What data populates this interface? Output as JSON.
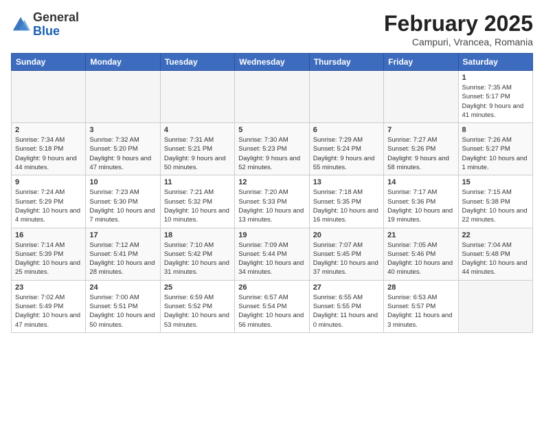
{
  "logo": {
    "general": "General",
    "blue": "Blue"
  },
  "title": {
    "month_year": "February 2025",
    "location": "Campuri, Vrancea, Romania"
  },
  "weekdays": [
    "Sunday",
    "Monday",
    "Tuesday",
    "Wednesday",
    "Thursday",
    "Friday",
    "Saturday"
  ],
  "weeks": [
    [
      {
        "day": "",
        "info": ""
      },
      {
        "day": "",
        "info": ""
      },
      {
        "day": "",
        "info": ""
      },
      {
        "day": "",
        "info": ""
      },
      {
        "day": "",
        "info": ""
      },
      {
        "day": "",
        "info": ""
      },
      {
        "day": "1",
        "info": "Sunrise: 7:35 AM\nSunset: 5:17 PM\nDaylight: 9 hours and 41 minutes."
      }
    ],
    [
      {
        "day": "2",
        "info": "Sunrise: 7:34 AM\nSunset: 5:18 PM\nDaylight: 9 hours and 44 minutes."
      },
      {
        "day": "3",
        "info": "Sunrise: 7:32 AM\nSunset: 5:20 PM\nDaylight: 9 hours and 47 minutes."
      },
      {
        "day": "4",
        "info": "Sunrise: 7:31 AM\nSunset: 5:21 PM\nDaylight: 9 hours and 50 minutes."
      },
      {
        "day": "5",
        "info": "Sunrise: 7:30 AM\nSunset: 5:23 PM\nDaylight: 9 hours and 52 minutes."
      },
      {
        "day": "6",
        "info": "Sunrise: 7:29 AM\nSunset: 5:24 PM\nDaylight: 9 hours and 55 minutes."
      },
      {
        "day": "7",
        "info": "Sunrise: 7:27 AM\nSunset: 5:26 PM\nDaylight: 9 hours and 58 minutes."
      },
      {
        "day": "8",
        "info": "Sunrise: 7:26 AM\nSunset: 5:27 PM\nDaylight: 10 hours and 1 minute."
      }
    ],
    [
      {
        "day": "9",
        "info": "Sunrise: 7:24 AM\nSunset: 5:29 PM\nDaylight: 10 hours and 4 minutes."
      },
      {
        "day": "10",
        "info": "Sunrise: 7:23 AM\nSunset: 5:30 PM\nDaylight: 10 hours and 7 minutes."
      },
      {
        "day": "11",
        "info": "Sunrise: 7:21 AM\nSunset: 5:32 PM\nDaylight: 10 hours and 10 minutes."
      },
      {
        "day": "12",
        "info": "Sunrise: 7:20 AM\nSunset: 5:33 PM\nDaylight: 10 hours and 13 minutes."
      },
      {
        "day": "13",
        "info": "Sunrise: 7:18 AM\nSunset: 5:35 PM\nDaylight: 10 hours and 16 minutes."
      },
      {
        "day": "14",
        "info": "Sunrise: 7:17 AM\nSunset: 5:36 PM\nDaylight: 10 hours and 19 minutes."
      },
      {
        "day": "15",
        "info": "Sunrise: 7:15 AM\nSunset: 5:38 PM\nDaylight: 10 hours and 22 minutes."
      }
    ],
    [
      {
        "day": "16",
        "info": "Sunrise: 7:14 AM\nSunset: 5:39 PM\nDaylight: 10 hours and 25 minutes."
      },
      {
        "day": "17",
        "info": "Sunrise: 7:12 AM\nSunset: 5:41 PM\nDaylight: 10 hours and 28 minutes."
      },
      {
        "day": "18",
        "info": "Sunrise: 7:10 AM\nSunset: 5:42 PM\nDaylight: 10 hours and 31 minutes."
      },
      {
        "day": "19",
        "info": "Sunrise: 7:09 AM\nSunset: 5:44 PM\nDaylight: 10 hours and 34 minutes."
      },
      {
        "day": "20",
        "info": "Sunrise: 7:07 AM\nSunset: 5:45 PM\nDaylight: 10 hours and 37 minutes."
      },
      {
        "day": "21",
        "info": "Sunrise: 7:05 AM\nSunset: 5:46 PM\nDaylight: 10 hours and 40 minutes."
      },
      {
        "day": "22",
        "info": "Sunrise: 7:04 AM\nSunset: 5:48 PM\nDaylight: 10 hours and 44 minutes."
      }
    ],
    [
      {
        "day": "23",
        "info": "Sunrise: 7:02 AM\nSunset: 5:49 PM\nDaylight: 10 hours and 47 minutes."
      },
      {
        "day": "24",
        "info": "Sunrise: 7:00 AM\nSunset: 5:51 PM\nDaylight: 10 hours and 50 minutes."
      },
      {
        "day": "25",
        "info": "Sunrise: 6:59 AM\nSunset: 5:52 PM\nDaylight: 10 hours and 53 minutes."
      },
      {
        "day": "26",
        "info": "Sunrise: 6:57 AM\nSunset: 5:54 PM\nDaylight: 10 hours and 56 minutes."
      },
      {
        "day": "27",
        "info": "Sunrise: 6:55 AM\nSunset: 5:55 PM\nDaylight: 11 hours and 0 minutes."
      },
      {
        "day": "28",
        "info": "Sunrise: 6:53 AM\nSunset: 5:57 PM\nDaylight: 11 hours and 3 minutes."
      },
      {
        "day": "",
        "info": ""
      }
    ]
  ]
}
